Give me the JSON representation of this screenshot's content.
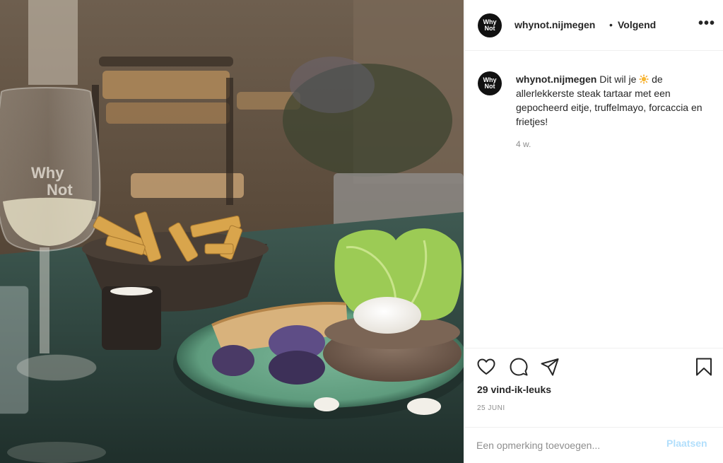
{
  "photo": {
    "glass_logo_line1": "Why",
    "glass_logo_line2": "Not"
  },
  "header": {
    "username": "whynot.nijmegen",
    "separator": "•",
    "follow_label": "Volgend",
    "more_glyph": "•••",
    "avatar_line1": "Why",
    "avatar_line2": "Not"
  },
  "caption": {
    "username": "whynot.nijmegen",
    "text_before": "Dit wil je",
    "emoji": "sun-emoji",
    "text_after": "de allerlekkerste steak tartaar met een gepocheerd eitje, truffelmayo, forcaccia en frietjes!",
    "age": "4 w."
  },
  "actions": {
    "icons": [
      "heart-icon",
      "comment-icon",
      "share-icon",
      "bookmark-icon"
    ],
    "likes": "29 vind-ik-leuks",
    "date": "25 JUNI"
  },
  "comment": {
    "placeholder": "Een opmerking toevoegen...",
    "post_label": "Plaatsen"
  },
  "colors": {
    "text": "#262626",
    "muted": "#8e8e8e",
    "divider": "#efefef",
    "post_disabled": "#b2dffc",
    "plate": "#6aa486",
    "table": "#2f4a44"
  }
}
